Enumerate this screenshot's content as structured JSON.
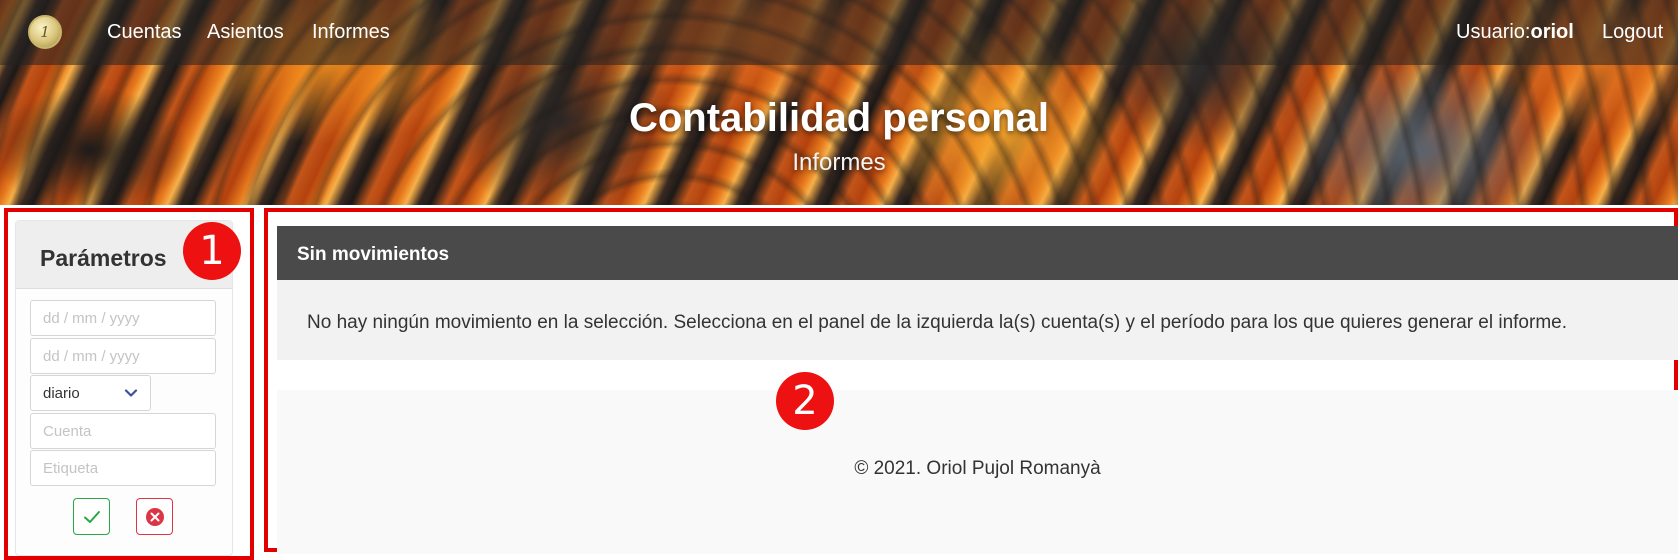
{
  "nav": {
    "logo_text": "1",
    "links": [
      {
        "label": "Cuentas"
      },
      {
        "label": "Asientos"
      },
      {
        "label": "Informes"
      }
    ],
    "user_prefix": "Usuario:",
    "user_name": "oriol",
    "logout_label": "Logout"
  },
  "hero": {
    "title": "Contabilidad personal",
    "subtitle": "Informes"
  },
  "sidebar": {
    "title": "Parámetros",
    "date_from_placeholder": "dd / mm / yyyy",
    "date_to_placeholder": "dd / mm / yyyy",
    "period_value": "diario",
    "account_placeholder": "Cuenta",
    "tag_placeholder": "Etiqueta",
    "confirm_icon": "check-icon",
    "cancel_icon": "close-circle-icon"
  },
  "main": {
    "header_title": "Sin movimientos",
    "message": "No hay ningún movimiento en la selección. Selecciona en el panel de la izquierda la(s) cuenta(s) y el período para los que quieres generar el informe."
  },
  "footer": {
    "text": "© 2021. Oriol Pujol Romanyà"
  },
  "annotations": {
    "badge_1": "1",
    "badge_2": "2"
  },
  "colors": {
    "accent_red": "#ee1111",
    "confirm_green": "#28a745",
    "cancel_red": "#dc3545",
    "header_dark": "#4a4a4a"
  }
}
